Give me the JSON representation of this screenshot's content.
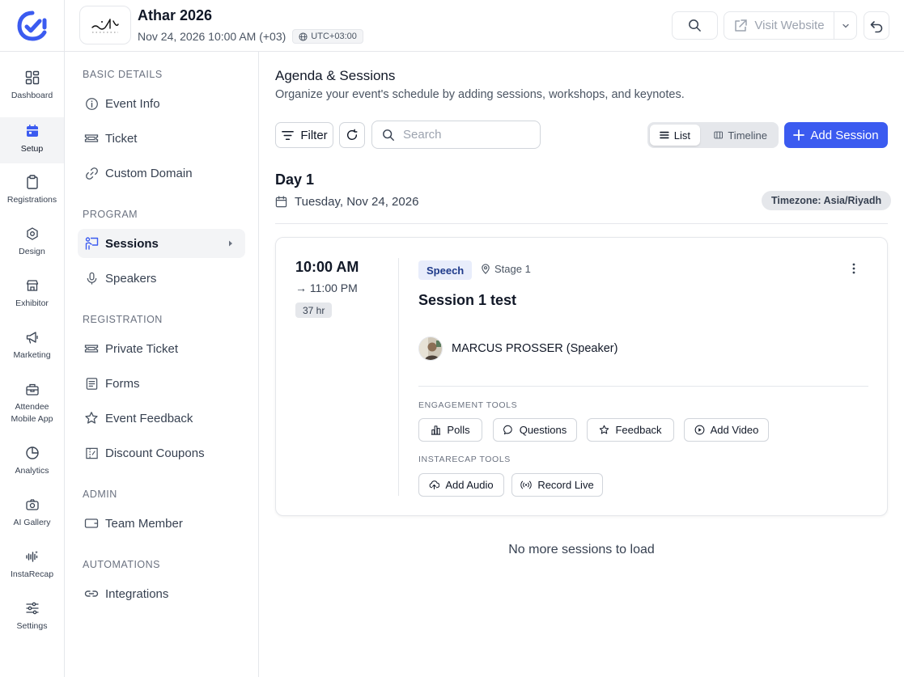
{
  "header": {
    "event_title": "Athar 2026",
    "event_datetime": "Nov 24, 2026 10:00 AM (+03)",
    "utc_offset": "UTC+03:00",
    "visit_website_label": "Visit Website"
  },
  "rail": {
    "items": [
      {
        "label": "Dashboard",
        "icon": "dashboard-icon"
      },
      {
        "label": "Setup",
        "icon": "calendar-icon",
        "active": true
      },
      {
        "label": "Registrations",
        "icon": "clipboard-icon"
      },
      {
        "label": "Design",
        "icon": "design-icon"
      },
      {
        "label": "Exhibitor",
        "icon": "store-icon"
      },
      {
        "label": "Marketing",
        "icon": "megaphone-icon"
      },
      {
        "label": "Attendee Mobile App",
        "icon": "mobile-app-icon"
      },
      {
        "label": "Analytics",
        "icon": "pie-chart-icon"
      },
      {
        "label": "AI Gallery",
        "icon": "camera-icon"
      },
      {
        "label": "InstaRecap",
        "icon": "audio-wave-icon"
      },
      {
        "label": "Settings",
        "icon": "sliders-icon"
      }
    ]
  },
  "sidebar": {
    "basic_details_title": "BASIC DETAILS",
    "event_info": "Event Info",
    "ticket": "Ticket",
    "custom_domain": "Custom Domain",
    "program_title": "PROGRAM",
    "sessions": "Sessions",
    "speakers": "Speakers",
    "registration_title": "REGISTRATION",
    "private_ticket": "Private Ticket",
    "forms": "Forms",
    "event_feedback": "Event Feedback",
    "discount_coupons": "Discount Coupons",
    "admin_title": "ADMIN",
    "team_member": "Team Member",
    "automations_title": "AUTOMATIONS",
    "integrations": "Integrations"
  },
  "main": {
    "title": "Agenda & Sessions",
    "subtitle": "Organize your event's schedule by adding sessions, workshops, and keynotes.",
    "filter_label": "Filter",
    "search_placeholder": "Search",
    "view_list": "List",
    "view_timeline": "Timeline",
    "add_session_label": "Add Session",
    "day_title": "Day 1",
    "day_date": "Tuesday, Nov 24, 2026",
    "timezone_badge": "Timezone: Asia/Riyadh",
    "no_more": "No more sessions to load"
  },
  "session": {
    "start": "10:00 AM",
    "end": "→ 11:00 PM",
    "duration": "37 hr",
    "tag": "Speech",
    "location": "Stage 1",
    "title": "Session 1 test",
    "speaker": "MARCUS PROSSER (Speaker)",
    "engagement_title": "ENGAGEMENT TOOLS",
    "polls": "Polls",
    "questions": "Questions",
    "feedback": "Feedback",
    "add_video": "Add Video",
    "instarecap_title": "INSTARECAP TOOLS",
    "add_audio": "Add Audio",
    "record_live": "Record Live"
  },
  "colors": {
    "accent": "#3b5bf0",
    "brand": "#3b5bf0",
    "tag_bg": "#e8edfb",
    "tag_text": "#1e3a8a"
  }
}
